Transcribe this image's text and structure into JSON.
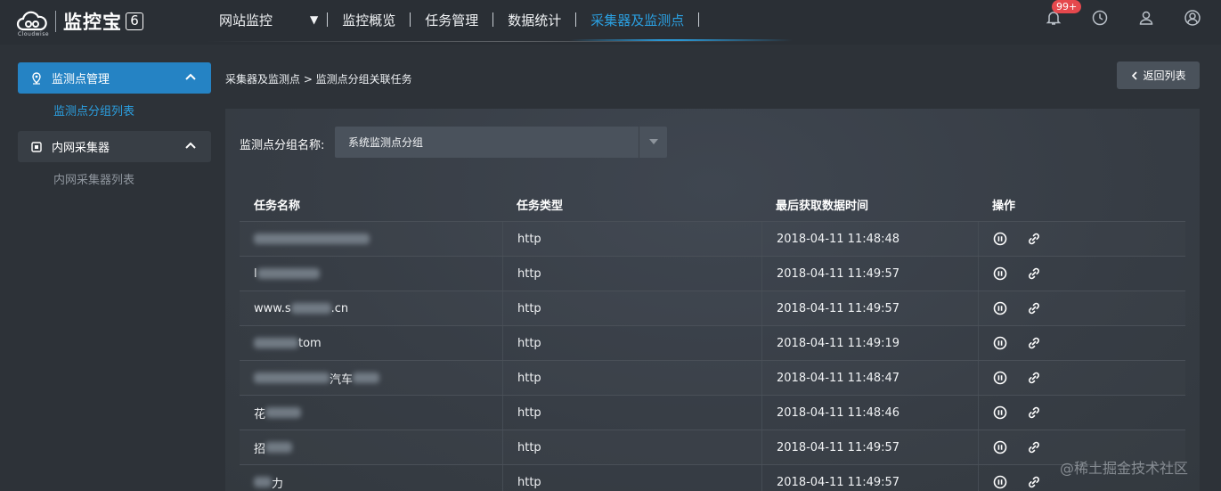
{
  "app": {
    "logo_text": "监控宝",
    "logo_version": "6",
    "logo_sub": "Cloudwise"
  },
  "nav": {
    "items": [
      "网站监控",
      "监控概览",
      "任务管理",
      "数据统计",
      "采集器及监测点"
    ],
    "active": "采集器及监测点",
    "notification_badge": "99+"
  },
  "sidebar": {
    "groups": [
      {
        "label": "监测点管理",
        "icon": "location-pin-icon",
        "sub": "监测点分组列表"
      },
      {
        "label": "内网采集器",
        "icon": "chip-icon",
        "sub": "内网采集器列表"
      }
    ]
  },
  "breadcrumb": "采集器及监测点 > 监测点分组关联任务",
  "back_button": "返回列表",
  "filter": {
    "label": "监测点分组名称:",
    "value": "系统监测点分组"
  },
  "table": {
    "headers": [
      "任务名称",
      "任务类型",
      "最后获取数据时间",
      "操作"
    ],
    "rows": [
      {
        "name_prefix": "",
        "name_suffix": "",
        "type": "http",
        "time": "2018-04-11 11:48:48"
      },
      {
        "name_prefix": "l",
        "name_suffix": "",
        "type": "http",
        "time": "2018-04-11 11:49:57"
      },
      {
        "name_prefix": "www.s",
        "name_suffix": ".cn",
        "type": "http",
        "time": "2018-04-11 11:49:57"
      },
      {
        "name_prefix": "",
        "name_suffix": "tom",
        "type": "http",
        "time": "2018-04-11 11:49:19"
      },
      {
        "name_prefix": "",
        "name_suffix": "汽车",
        "type": "http",
        "time": "2018-04-11 11:48:47"
      },
      {
        "name_prefix": "花",
        "name_suffix": "",
        "type": "http",
        "time": "2018-04-11 11:48:46"
      },
      {
        "name_prefix": "招",
        "name_suffix": "",
        "type": "http",
        "time": "2018-04-11 11:49:57"
      },
      {
        "name_prefix": "",
        "name_suffix": "力",
        "type": "http",
        "time": "2018-04-11 11:49:57"
      }
    ]
  },
  "watermark": "@稀土掘金技术社区"
}
